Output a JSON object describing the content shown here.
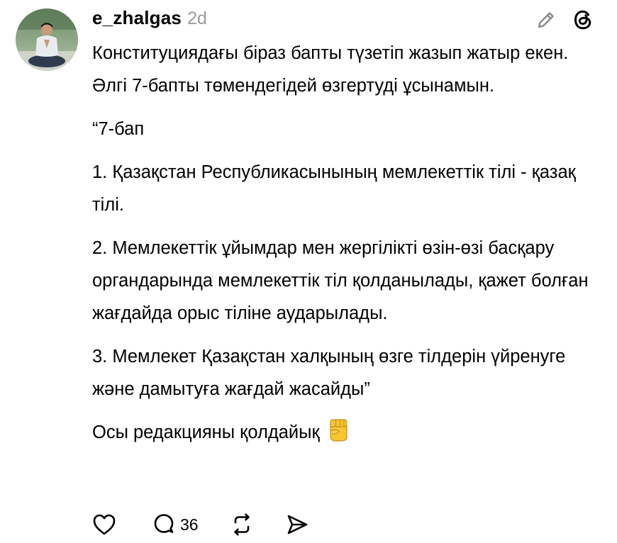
{
  "post": {
    "username": "e_zhalgas",
    "timestamp": "2d",
    "paragraphs": [
      "Конституциядағы біраз бапты түзетіп жазып жатыр екен. Әлгі 7-бапты төмендегідей өзгертуді ұсынамын.",
      "“7-бап",
      "1. Қазақстан Республикасынының мемлекеттік тілі - қазақ тілі.",
      "2. Мемлекеттік ұйымдар мен жергілікті өзін-өзі басқару органдарында мемлекеттік тіл қолданылады, қажет болған жағдайда орыс тіліне аударылады.",
      "3. Мемлекет Қазақстан халқының өзге тілдерін үйренуге және дамытуға жағдай жасайды”",
      "Осы редакцияны қолдайық"
    ],
    "closing_emoji": "raised-fist-emoji"
  },
  "actions": {
    "like_icon": "heart-icon",
    "reply_icon": "comment-icon",
    "reply_count": "36",
    "repost_icon": "repost-icon",
    "share_icon": "send-icon"
  },
  "header_icons": {
    "edit": "pencil-icon",
    "app": "threads-logo-icon"
  },
  "colors": {
    "text": "#000000",
    "muted": "#9a9a9a",
    "background": "#ffffff"
  }
}
